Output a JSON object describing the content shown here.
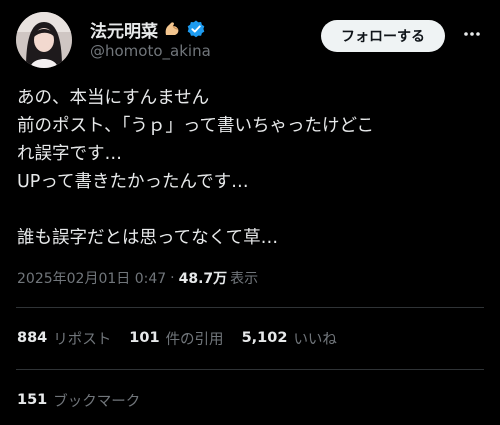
{
  "author": {
    "display_name": "法元明菜",
    "handle": "@homoto_akina",
    "emoji": "flexed-biceps",
    "verified_color": "#1d9bf0"
  },
  "header": {
    "follow_label": "フォローする",
    "more_icon": "more-horizontal-icon"
  },
  "tweet": {
    "lines": [
      "あの、本当にすんません",
      "前のポスト、「うｐ」って書いちゃったけどこ",
      "れ誤字です…",
      "UPって書きたかったんです…",
      "",
      "誰も誤字だとは思ってなくて草…"
    ]
  },
  "meta": {
    "timestamp": "2025年02月01日 0:47",
    "separator": "·",
    "views_count": "48.7万",
    "views_label": "表示"
  },
  "stats": {
    "reposts_count": "884",
    "reposts_label": "リポスト",
    "quotes_count": "101",
    "quotes_label": "件の引用",
    "likes_count": "5,102",
    "likes_label": "いいね",
    "bookmarks_count": "151",
    "bookmarks_label": "ブックマーク"
  },
  "colors": {
    "background": "#000000",
    "text_primary": "#e7e9ea",
    "text_secondary": "#71767b",
    "divider": "#2f3336",
    "follow_button_bg": "#eff3f4",
    "follow_button_text": "#0f1419"
  }
}
